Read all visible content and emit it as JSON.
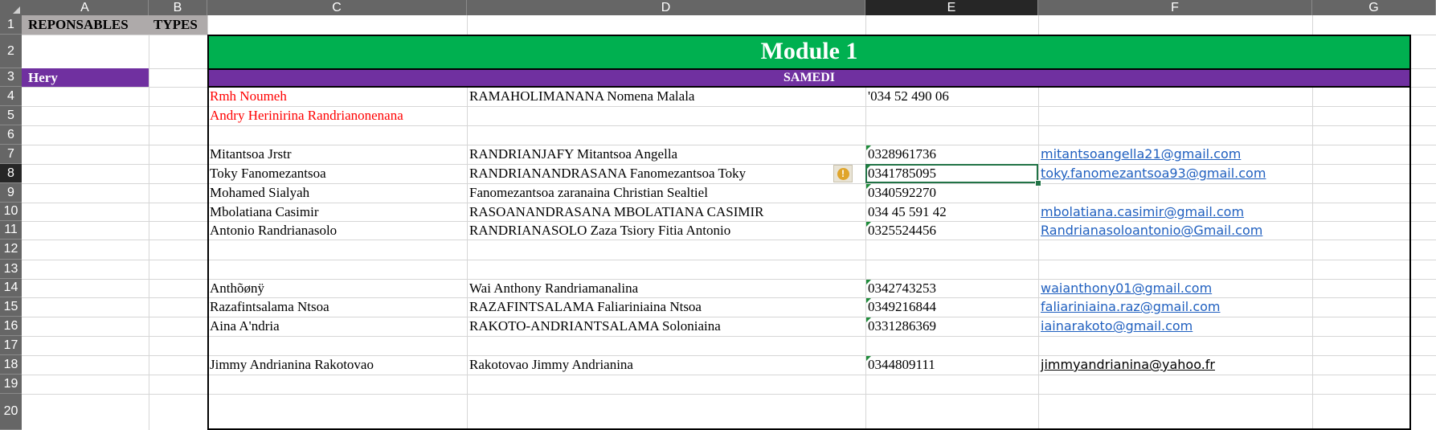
{
  "columns": [
    "A",
    "B",
    "C",
    "D",
    "E",
    "F",
    "G"
  ],
  "rows": [
    "1",
    "2",
    "3",
    "4",
    "5",
    "6",
    "7",
    "8",
    "9",
    "10",
    "11",
    "12",
    "13",
    "14",
    "15",
    "16",
    "17",
    "18",
    "19",
    "20"
  ],
  "selected_cell": "E8",
  "header": {
    "responsables": "REPONSABLES",
    "types": "TYPES"
  },
  "module_title": "Module 1",
  "day_label": "SAMEDI",
  "responsable_name": "Hery",
  "colors": {
    "module_bg": "#00b050",
    "day_bg": "#7030a0",
    "header_bg": "#aeaaaa",
    "link": "#1f5fbf",
    "red_text": "#ff0000",
    "selection": "#217346"
  },
  "entries": [
    {
      "row": 4,
      "nickname": "Rmh Noumeh",
      "fullname": "RAMAHOLIMANANA Nomena Malala",
      "phone": "'034 52 490 06",
      "email": "",
      "red": true
    },
    {
      "row": 5,
      "nickname": "Andry Herinirina Randrianonenana",
      "fullname": "",
      "phone": "",
      "email": "",
      "red": true
    },
    {
      "row": 7,
      "nickname": "Mitantsoa Jrstr",
      "fullname": "RANDRIANJAFY Mitantsoa Angella",
      "phone": "0328961736",
      "email": " mitantsoangella21@gmail.com"
    },
    {
      "row": 8,
      "nickname": "Toky Fanomezantsoa",
      "fullname": "RANDRIANANDRASANA Fanomezantsoa Toky",
      "phone": "0341785095",
      "email": "toky.fanomezantsoa93@gmail.com"
    },
    {
      "row": 9,
      "nickname": "Mohamed Sialyah",
      "fullname": "Fanomezantsoa zaranaina Christian Sealtiel",
      "phone": "0340592270",
      "email": ""
    },
    {
      "row": 10,
      "nickname": "Mbolatiana Casimir",
      "fullname": "RASOANANDRASANA MBOLATIANA CASIMIR",
      "phone": "034 45 591 42",
      "email": "mbolatiana.casimir@gmail.com"
    },
    {
      "row": 11,
      "nickname": "Antonio Randrianasolo",
      "fullname": "RANDRIANASOLO Zaza Tsiory Fitia Antonio",
      "phone": "0325524456",
      "email": "Randrianasoloantonio@Gmail.com "
    },
    {
      "row": 14,
      "nickname": "Anthõønÿ",
      "fullname": "Wai Anthony Randriamanalina",
      "phone": "0342743253",
      "email": "waianthony01@gmail.com"
    },
    {
      "row": 15,
      "nickname": "Razafintsalama Ntsoa",
      "fullname": "RAZAFINTSALAMA Faliariniaina Ntsoa",
      "phone": "0349216844",
      "email": "faliariniaina.raz@gmail.com"
    },
    {
      "row": 16,
      "nickname": "Aina A'ndria",
      "fullname": "RAKOTO-ANDRIANTSALAMA Soloniaina",
      "phone": "0331286369",
      "email": "iainarakoto@gmail.com"
    },
    {
      "row": 18,
      "nickname": "Jimmy Andrianina Rakotovao",
      "fullname": "Rakotovao Jimmy Andrianina",
      "phone": "0344809111",
      "email": "jimmyandrianina@yahoo.fr",
      "black_email": true
    }
  ]
}
